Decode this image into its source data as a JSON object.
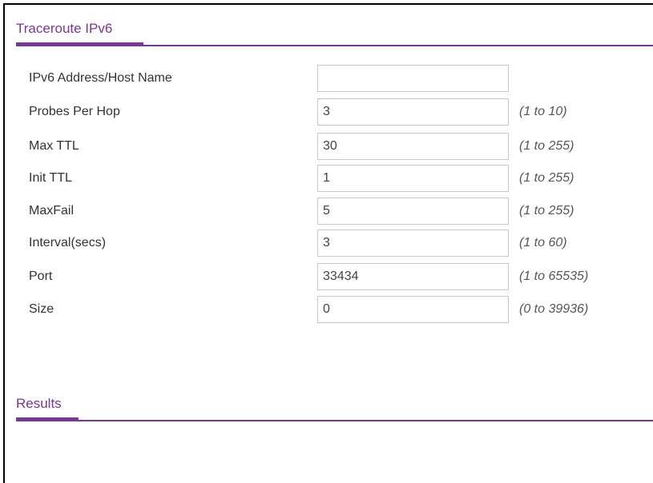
{
  "sections": {
    "traceroute_title": "Traceroute IPv6",
    "results_title": "Results"
  },
  "fields": [
    {
      "label": "IPv6 Address/Host Name",
      "value": "",
      "range": ""
    },
    {
      "label": "Probes Per Hop",
      "value": "3",
      "range": "(1 to 10)"
    },
    {
      "label": "Max TTL",
      "value": "30",
      "range": "(1 to 255)"
    },
    {
      "label": "Init TTL",
      "value": "1",
      "range": "(1 to 255)"
    },
    {
      "label": "MaxFail",
      "value": "5",
      "range": "(1 to 255)"
    },
    {
      "label": "Interval(secs)",
      "value": "3",
      "range": "(1 to 60)"
    },
    {
      "label": "Port",
      "value": "33434",
      "range": "(1 to 65535)"
    },
    {
      "label": "Size",
      "value": "0",
      "range": "(0 to 39936)"
    }
  ],
  "colors": {
    "accent": "#7a3598",
    "input_border": "#c9c9c9"
  }
}
